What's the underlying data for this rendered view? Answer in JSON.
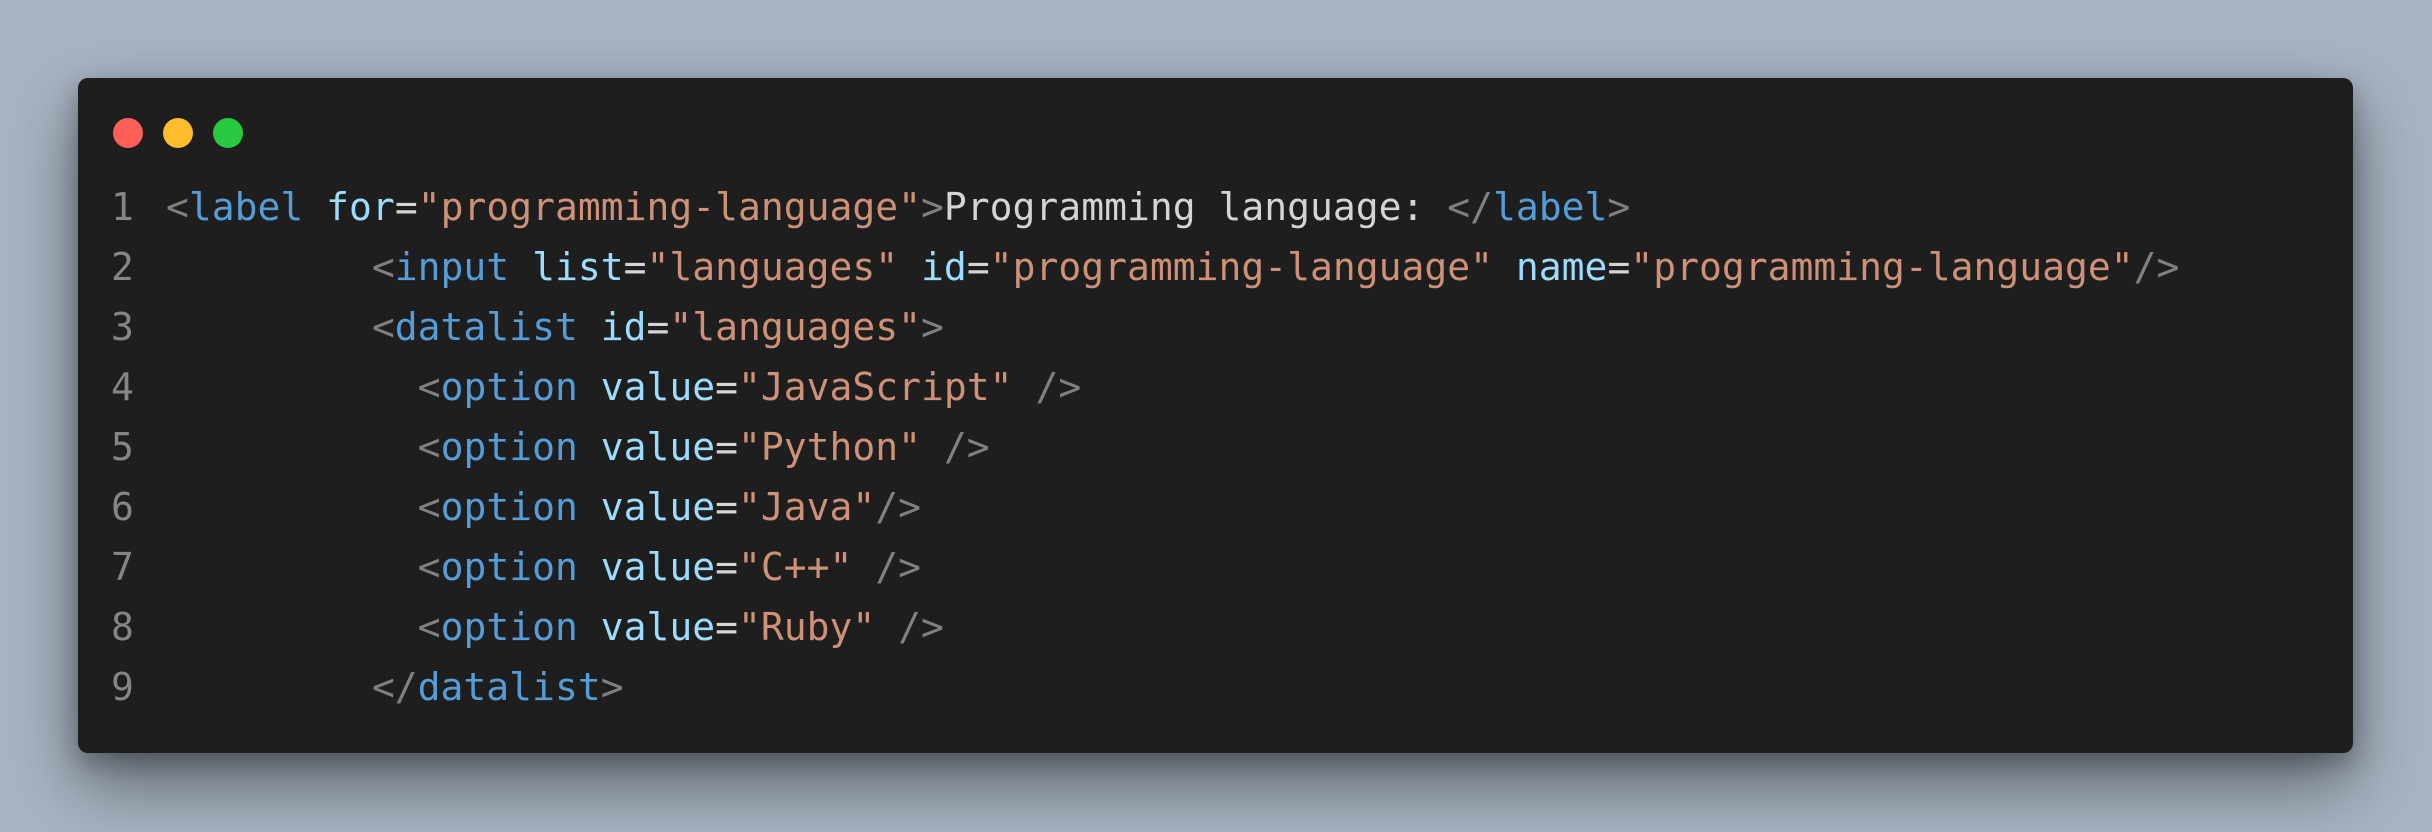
{
  "window": {
    "controls": [
      "close",
      "minimize",
      "maximize"
    ],
    "colors": {
      "close": "#fe5f57",
      "minimize": "#febc2e",
      "maximize": "#28c840",
      "background": "#1e1e1e"
    }
  },
  "code": {
    "lines": [
      {
        "num": "1",
        "indent": "",
        "tokens": [
          {
            "t": "<",
            "c": "p"
          },
          {
            "t": "label",
            "c": "tg"
          },
          {
            "t": " ",
            "c": "tx"
          },
          {
            "t": "for",
            "c": "at"
          },
          {
            "t": "=",
            "c": "tx"
          },
          {
            "t": "\"programming-language\"",
            "c": "st"
          },
          {
            "t": ">",
            "c": "p"
          },
          {
            "t": "Programming language: ",
            "c": "tx"
          },
          {
            "t": "</",
            "c": "p"
          },
          {
            "t": "label",
            "c": "tg"
          },
          {
            "t": ">",
            "c": "p"
          }
        ]
      },
      {
        "num": "2",
        "indent": "         ",
        "tokens": [
          {
            "t": "<",
            "c": "p"
          },
          {
            "t": "input",
            "c": "tg"
          },
          {
            "t": " ",
            "c": "tx"
          },
          {
            "t": "list",
            "c": "at"
          },
          {
            "t": "=",
            "c": "tx"
          },
          {
            "t": "\"languages\"",
            "c": "st"
          },
          {
            "t": " ",
            "c": "tx"
          },
          {
            "t": "id",
            "c": "at"
          },
          {
            "t": "=",
            "c": "tx"
          },
          {
            "t": "\"programming-language\"",
            "c": "st"
          },
          {
            "t": " ",
            "c": "tx"
          },
          {
            "t": "name",
            "c": "at"
          },
          {
            "t": "=",
            "c": "tx"
          },
          {
            "t": "\"programming-language\"",
            "c": "st"
          },
          {
            "t": "/>",
            "c": "p"
          }
        ]
      },
      {
        "num": "3",
        "indent": "         ",
        "tokens": [
          {
            "t": "<",
            "c": "p"
          },
          {
            "t": "datalist",
            "c": "tg"
          },
          {
            "t": " ",
            "c": "tx"
          },
          {
            "t": "id",
            "c": "at"
          },
          {
            "t": "=",
            "c": "tx"
          },
          {
            "t": "\"languages\"",
            "c": "st"
          },
          {
            "t": ">",
            "c": "p"
          }
        ]
      },
      {
        "num": "4",
        "indent": "           ",
        "tokens": [
          {
            "t": "<",
            "c": "p"
          },
          {
            "t": "option",
            "c": "tg"
          },
          {
            "t": " ",
            "c": "tx"
          },
          {
            "t": "value",
            "c": "at"
          },
          {
            "t": "=",
            "c": "tx"
          },
          {
            "t": "\"JavaScript\"",
            "c": "st"
          },
          {
            "t": " />",
            "c": "p"
          }
        ]
      },
      {
        "num": "5",
        "indent": "           ",
        "tokens": [
          {
            "t": "<",
            "c": "p"
          },
          {
            "t": "option",
            "c": "tg"
          },
          {
            "t": " ",
            "c": "tx"
          },
          {
            "t": "value",
            "c": "at"
          },
          {
            "t": "=",
            "c": "tx"
          },
          {
            "t": "\"Python\"",
            "c": "st"
          },
          {
            "t": " />",
            "c": "p"
          }
        ]
      },
      {
        "num": "6",
        "indent": "           ",
        "tokens": [
          {
            "t": "<",
            "c": "p"
          },
          {
            "t": "option",
            "c": "tg"
          },
          {
            "t": " ",
            "c": "tx"
          },
          {
            "t": "value",
            "c": "at"
          },
          {
            "t": "=",
            "c": "tx"
          },
          {
            "t": "\"Java\"",
            "c": "st"
          },
          {
            "t": "/>",
            "c": "p"
          }
        ]
      },
      {
        "num": "7",
        "indent": "           ",
        "tokens": [
          {
            "t": "<",
            "c": "p"
          },
          {
            "t": "option",
            "c": "tg"
          },
          {
            "t": " ",
            "c": "tx"
          },
          {
            "t": "value",
            "c": "at"
          },
          {
            "t": "=",
            "c": "tx"
          },
          {
            "t": "\"C++\"",
            "c": "st"
          },
          {
            "t": " />",
            "c": "p"
          }
        ]
      },
      {
        "num": "8",
        "indent": "           ",
        "tokens": [
          {
            "t": "<",
            "c": "p"
          },
          {
            "t": "option",
            "c": "tg"
          },
          {
            "t": " ",
            "c": "tx"
          },
          {
            "t": "value",
            "c": "at"
          },
          {
            "t": "=",
            "c": "tx"
          },
          {
            "t": "\"Ruby\"",
            "c": "st"
          },
          {
            "t": " />",
            "c": "p"
          }
        ]
      },
      {
        "num": "9",
        "indent": "         ",
        "tokens": [
          {
            "t": "</",
            "c": "p"
          },
          {
            "t": "datalist",
            "c": "tg"
          },
          {
            "t": ">",
            "c": "p"
          }
        ]
      }
    ]
  }
}
